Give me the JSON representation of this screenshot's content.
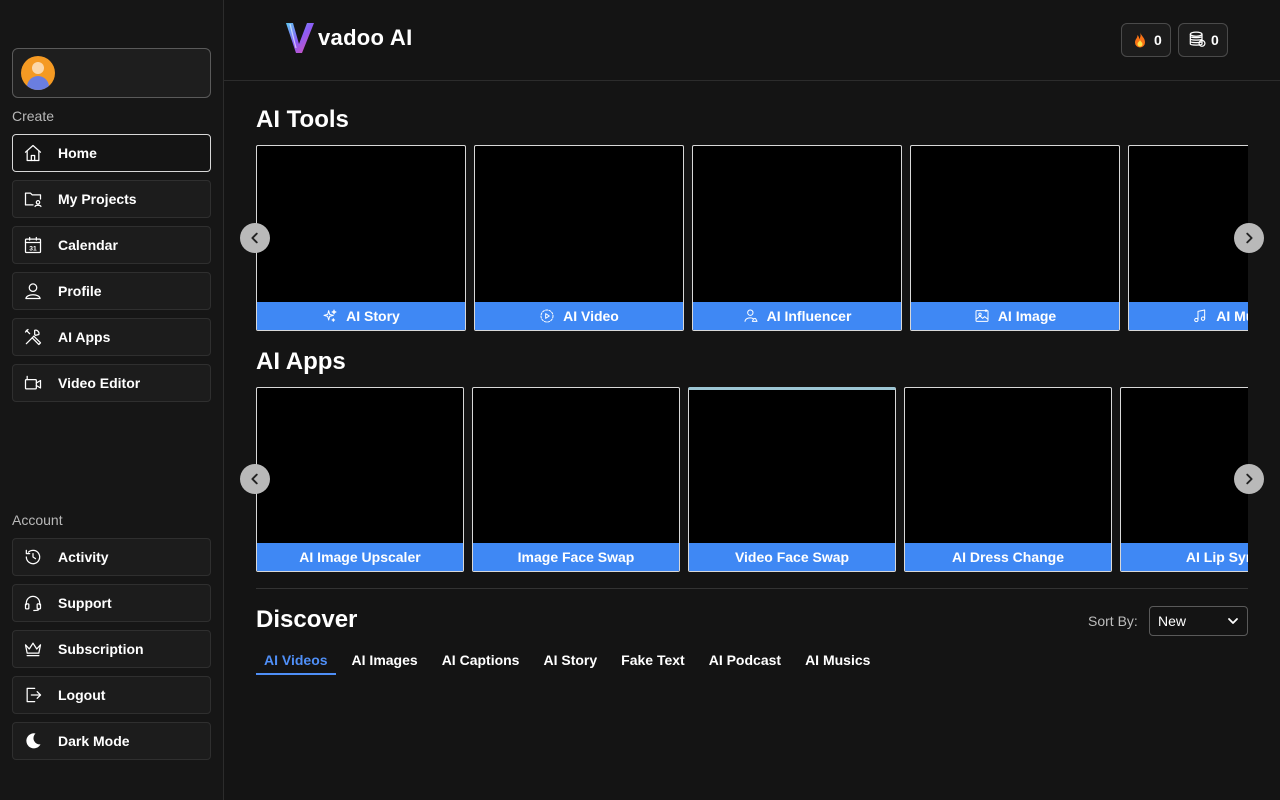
{
  "sidebar": {
    "create_label": "Create",
    "account_label": "Account",
    "create_items": [
      {
        "label": "Home",
        "icon": "home-icon"
      },
      {
        "label": "My Projects",
        "icon": "folder-user-icon"
      },
      {
        "label": "Calendar",
        "icon": "calendar-icon",
        "icon_text": "31"
      },
      {
        "label": "Profile",
        "icon": "user-icon"
      },
      {
        "label": "AI Apps",
        "icon": "tools-icon"
      },
      {
        "label": "Video Editor",
        "icon": "video-camera-icon"
      }
    ],
    "account_items": [
      {
        "label": "Activity",
        "icon": "history-icon"
      },
      {
        "label": "Support",
        "icon": "headset-icon"
      },
      {
        "label": "Subscription",
        "icon": "crown-icon"
      },
      {
        "label": "Logout",
        "icon": "logout-icon"
      },
      {
        "label": "Dark Mode",
        "icon": "moon-icon"
      }
    ]
  },
  "header": {
    "logo_text": "vadoo AI",
    "streak_count": "0",
    "credits_count": "0"
  },
  "ai_tools": {
    "title": "AI Tools",
    "cards": [
      {
        "label": "AI Story",
        "icon": "sparkles-icon"
      },
      {
        "label": "AI Video",
        "icon": "play-circle-icon"
      },
      {
        "label": "AI Influencer",
        "icon": "influencer-icon"
      },
      {
        "label": "AI Image",
        "icon": "image-icon"
      },
      {
        "label": "AI Music",
        "icon": "music-note-icon"
      }
    ]
  },
  "ai_apps": {
    "title": "AI Apps",
    "cards": [
      {
        "label": "AI Image Upscaler"
      },
      {
        "label": "Image Face Swap"
      },
      {
        "label": "Video Face Swap"
      },
      {
        "label": "AI Dress Change"
      },
      {
        "label": "AI Lip Sync"
      }
    ]
  },
  "discover": {
    "title": "Discover",
    "sort_label": "Sort By:",
    "sort_value": "New",
    "tabs": [
      "AI Videos",
      "AI Images",
      "AI Captions",
      "AI Story",
      "Fake Text",
      "AI Podcast",
      "AI Musics"
    ]
  },
  "colors": {
    "accent_blue": "#3f88f4",
    "tab_active": "#4f8ff7",
    "background": "#141414"
  }
}
